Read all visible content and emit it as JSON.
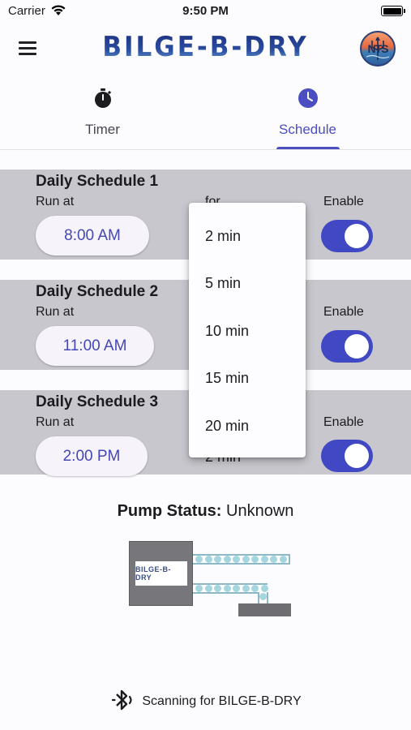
{
  "status_bar": {
    "carrier": "Carrier",
    "time": "9:50 PM"
  },
  "app_bar": {
    "title": "BILGE-B-DRY",
    "avatar_text": "NTS"
  },
  "tabs": [
    {
      "label": "Timer",
      "icon": "stopwatch-icon",
      "selected": false
    },
    {
      "label": "Schedule",
      "icon": "clock-icon",
      "selected": true
    }
  ],
  "labels": {
    "run_at": "Run at",
    "for": "for",
    "enable": "Enable"
  },
  "schedules": [
    {
      "title": "Daily Schedule 1",
      "time": "8:00 AM",
      "duration": "",
      "enabled": true
    },
    {
      "title": "Daily Schedule 2",
      "time": "11:00 AM",
      "duration": "",
      "enabled": true
    },
    {
      "title": "Daily Schedule 3",
      "time": "2:00 PM",
      "duration": "2 min",
      "enabled": true
    }
  ],
  "dropdown": {
    "options": [
      "2 min",
      "5 min",
      "10 min",
      "15 min",
      "20 min"
    ]
  },
  "pump": {
    "status_label": "Pump Status:",
    "status_value": "Unknown",
    "plate_text": "BILGE-B-DRY"
  },
  "footer": {
    "bluetooth_text": "Scanning for BILGE-B-DRY"
  },
  "colors": {
    "accent": "#4a4ec0",
    "card_bg": "#c8c7cd",
    "toggle_on": "#4148c4"
  }
}
